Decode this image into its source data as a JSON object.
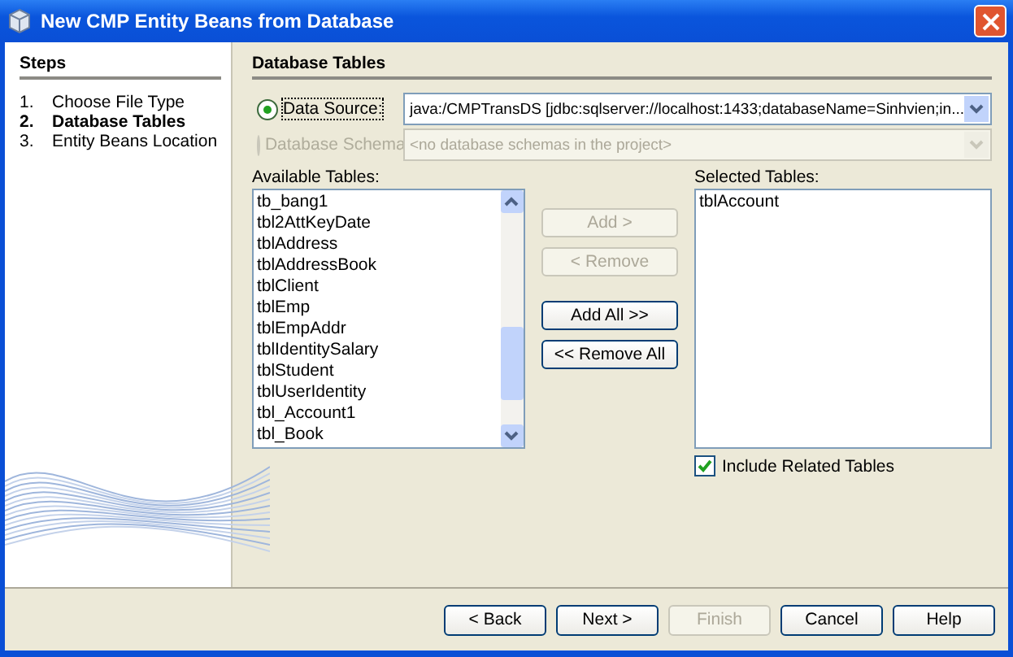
{
  "window": {
    "title": "New CMP Entity Beans from Database"
  },
  "steps": {
    "heading": "Steps",
    "items": [
      {
        "number": "1.",
        "label": "Choose File Type",
        "selected": false
      },
      {
        "number": "2.",
        "label": "Database Tables",
        "selected": true
      },
      {
        "number": "3.",
        "label": "Entity Beans Location",
        "selected": false
      }
    ]
  },
  "panel": {
    "heading": "Database Tables",
    "sources": [
      {
        "label": "Data Source:",
        "selected": true,
        "disabled": false,
        "value": "java:/CMPTransDS [jdbc:sqlserver://localhost:1433;databaseName=Sinhvien;in..."
      },
      {
        "label": "Database Schema",
        "selected": false,
        "disabled": true,
        "placeholder": "<no database schemas in the project>"
      }
    ],
    "available": {
      "label": "Available Tables:",
      "items": [
        "tb_bang1",
        "tbl2AttKeyDate",
        "tblAddress",
        "tblAddressBook",
        "tblClient",
        "tblEmp",
        "tblEmpAddr",
        "tblIdentitySalary",
        "tblStudent",
        "tblUserIdentity",
        "tbl_Account1",
        "tbl_Book"
      ]
    },
    "move_buttons": [
      {
        "label": "Add >",
        "disabled": true
      },
      {
        "label": "< Remove",
        "disabled": true
      },
      {
        "label": "Add All >>",
        "disabled": false
      },
      {
        "label": "<< Remove All",
        "disabled": false
      }
    ],
    "selected_tables": {
      "label": "Selected Tables:",
      "items": [
        "tblAccount"
      ]
    },
    "include_related": {
      "label": "Include Related Tables",
      "checked": true
    }
  },
  "buttons": [
    {
      "label": "< Back",
      "disabled": false
    },
    {
      "label": "Next >",
      "disabled": false
    },
    {
      "label": "Finish",
      "disabled": true
    },
    {
      "label": "Cancel",
      "disabled": false
    },
    {
      "label": "Help",
      "disabled": false
    }
  ]
}
